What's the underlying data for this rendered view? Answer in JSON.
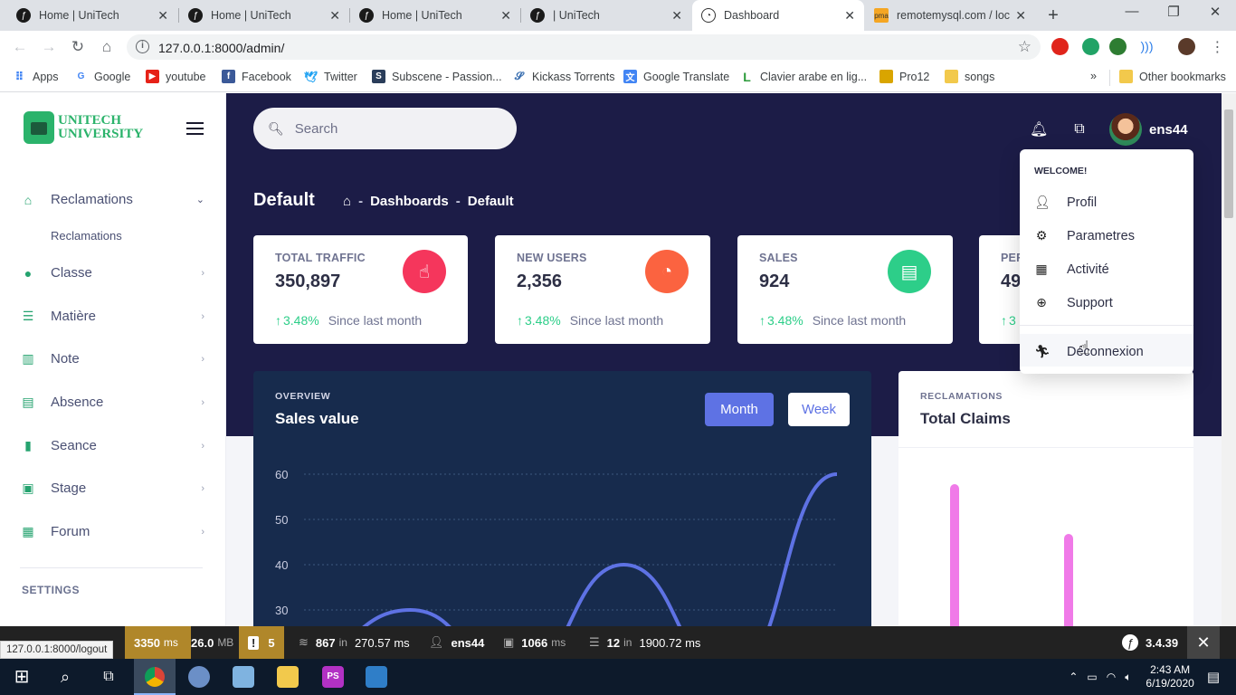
{
  "browser": {
    "tabs": [
      {
        "label": "Home | UniTech"
      },
      {
        "label": "Home | UniTech"
      },
      {
        "label": "Home | UniTech"
      },
      {
        "label": "| UniTech"
      },
      {
        "label": "Dashboard"
      },
      {
        "label": "remotemysql.com / loc"
      }
    ],
    "url": "127.0.0.1:8000/admin/",
    "bookmarks": [
      {
        "label": "Apps",
        "color": "#4285f4"
      },
      {
        "label": "Google",
        "color": "#4285f4"
      },
      {
        "label": "youtube",
        "color": "#e62117"
      },
      {
        "label": "Facebook",
        "color": "#3b5998"
      },
      {
        "label": "Twitter",
        "color": "#1da1f2"
      },
      {
        "label": "Subscene - Passion...",
        "color": "#2a3d5a"
      },
      {
        "label": "Kickass Torrents",
        "color": "#3a6fb0"
      },
      {
        "label": "Google Translate",
        "color": "#4285f4"
      },
      {
        "label": "Clavier arabe en lig...",
        "color": "#2b9a3a"
      },
      {
        "label": "Pro12",
        "color": "#d9a500"
      },
      {
        "label": "songs",
        "color": "#f2c94c"
      }
    ],
    "overflow": "»",
    "other_bookmarks": "Other bookmarks"
  },
  "sidebar": {
    "logo_line1": "UNITECH",
    "logo_line2": "UNIVERSITY",
    "items": [
      {
        "label": "Reclamations",
        "icon": "store-icon"
      },
      {
        "label": "Classe",
        "icon": "chat-icon"
      },
      {
        "label": "Matière",
        "icon": "align-left-icon"
      },
      {
        "label": "Note",
        "icon": "books-icon"
      },
      {
        "label": "Absence",
        "icon": "calendar-list-icon"
      },
      {
        "label": "Seance",
        "icon": "book-open-icon"
      },
      {
        "label": "Stage",
        "icon": "image-icon"
      },
      {
        "label": "Forum",
        "icon": "hospital-icon"
      }
    ],
    "subitem": "Reclamations",
    "settings_label": "SETTINGS"
  },
  "header": {
    "search_placeholder": "Search",
    "username": "ens44"
  },
  "page_title": "Default",
  "breadcrumb": {
    "dashboards": "Dashboards",
    "current": "Default"
  },
  "stats": [
    {
      "label": "TOTAL TRAFFIC",
      "value": "350,897",
      "change": "3.48%",
      "since": "Since last month",
      "color": "#f5365c",
      "icon": "hand-pointer-icon"
    },
    {
      "label": "NEW USERS",
      "value": "2,356",
      "change": "3.48%",
      "since": "Since last month",
      "color": "#fb6340",
      "icon": "pie-chart-icon"
    },
    {
      "label": "SALES",
      "value": "924",
      "change": "3.48%",
      "since": "Since last month",
      "color": "#2dce89",
      "icon": "money-coins-icon"
    },
    {
      "label": "PER",
      "value": "49",
      "change": "3",
      "since": "",
      "color": "#11cdef",
      "icon": "percent-icon"
    }
  ],
  "overview": {
    "kicker": "OVERVIEW",
    "title": "Sales value",
    "btn_month": "Month",
    "btn_week": "Week"
  },
  "claims": {
    "kicker": "RECLAMATIONS",
    "title": "Total Claims"
  },
  "dropdown": {
    "header": "WELCOME!",
    "items": [
      {
        "label": "Profil",
        "icon": "user-icon"
      },
      {
        "label": "Parametres",
        "icon": "gear-icon"
      },
      {
        "label": "Activité",
        "icon": "calendar-icon"
      },
      {
        "label": "Support",
        "icon": "lifebuoy-icon"
      }
    ],
    "logout": "Déconnexion"
  },
  "chart_data": [
    {
      "type": "line",
      "title": "Sales value",
      "ylim": [
        30,
        60
      ],
      "yticks": [
        "60",
        "50",
        "40",
        "30"
      ],
      "series": [
        {
          "values": [
            20,
            30,
            15,
            40,
            15,
            60
          ]
        }
      ],
      "grid": true
    },
    {
      "type": "bar",
      "title": "Total Claims",
      "series": [
        {
          "values": [
            30,
            20
          ]
        }
      ],
      "color": "#f07ae8"
    }
  ],
  "symfony": {
    "time": "3350",
    "time_unit": "ms",
    "memory": "26.0",
    "memory_unit": "MB",
    "warnings": "5",
    "events": "867",
    "events_in": "in",
    "events_time": "270.57 ms",
    "user": "ens44",
    "twig": "1066",
    "twig_unit": "ms",
    "db": "12",
    "db_in": "in",
    "db_time": "1900.72 ms",
    "version": "3.4.39",
    "status_link": "127.0.0.1:8000/logout"
  },
  "taskbar": {
    "time": "2:43 AM",
    "date": "6/19/2020"
  }
}
